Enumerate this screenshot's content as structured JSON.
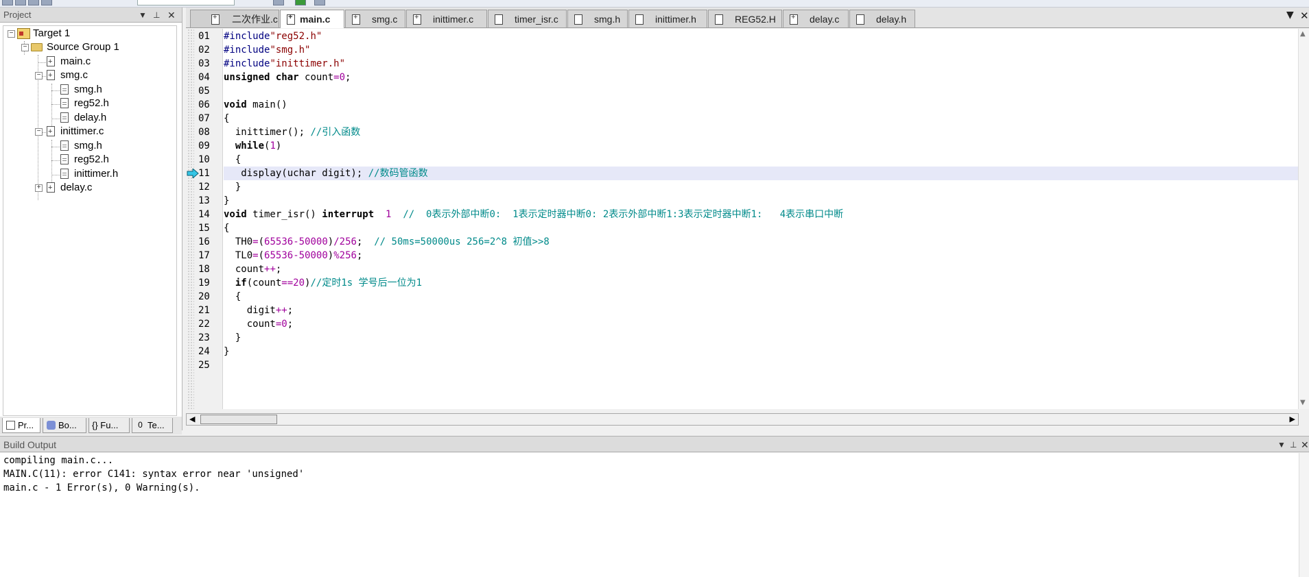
{
  "project_panel": {
    "title": "Project",
    "tree": {
      "target": "Target 1",
      "group": "Source Group 1",
      "main": "main.c",
      "smg": "smg.c",
      "smg_children": [
        "smg.h",
        "reg52.h",
        "delay.h"
      ],
      "inittimer": "inittimer.c",
      "inittimer_children": [
        "smg.h",
        "reg52.h",
        "inittimer.h"
      ],
      "delay": "delay.c"
    },
    "tabs": [
      "Pr...",
      "Bo...",
      "{} Fu...",
      "Te..."
    ]
  },
  "file_tabs": [
    "二次作业.c",
    "main.c",
    "smg.c",
    "inittimer.c",
    "timer_isr.c",
    "smg.h",
    "inittimer.h",
    "REG52.H",
    "delay.c",
    "delay.h"
  ],
  "active_tab": "main.c",
  "editor": {
    "current_line": 11,
    "lines": [
      {
        "n": "01",
        "t": "#include\"reg52.h\""
      },
      {
        "n": "02",
        "t": "#include\"smg.h\""
      },
      {
        "n": "03",
        "t": "#include\"inittimer.h\""
      },
      {
        "n": "04",
        "t": "unsigned char count=0;"
      },
      {
        "n": "05",
        "t": ""
      },
      {
        "n": "06",
        "t": "void main()"
      },
      {
        "n": "07",
        "t": "{"
      },
      {
        "n": "08",
        "t": "  inittimer(); //引入函数"
      },
      {
        "n": "09",
        "t": "  while(1)"
      },
      {
        "n": "10",
        "t": "  {"
      },
      {
        "n": "11",
        "t": "   display(uchar digit); //数码管函数"
      },
      {
        "n": "12",
        "t": "  }"
      },
      {
        "n": "13",
        "t": "}"
      },
      {
        "n": "14",
        "t": "void timer_isr() interrupt  1  //  0表示外部中断0:  1表示定时器中断0: 2表示外部中断1:3表示定时器中断1:   4表示串口中断"
      },
      {
        "n": "15",
        "t": "{"
      },
      {
        "n": "16",
        "t": "  TH0=(65536-50000)/256;  // 50ms=50000us 256=2^8 初值>>8"
      },
      {
        "n": "17",
        "t": "  TL0=(65536-50000)%256;"
      },
      {
        "n": "18",
        "t": "  count++;"
      },
      {
        "n": "19",
        "t": "  if(count==20)//定时1s 学号后一位为1"
      },
      {
        "n": "20",
        "t": "  {"
      },
      {
        "n": "21",
        "t": "    digit++;"
      },
      {
        "n": "22",
        "t": "    count=0;"
      },
      {
        "n": "23",
        "t": "  }"
      },
      {
        "n": "24",
        "t": "}"
      },
      {
        "n": "25",
        "t": ""
      }
    ]
  },
  "build_output": {
    "title": "Build Output",
    "lines": [
      "compiling main.c...",
      "MAIN.C(11): error C141: syntax error near 'unsigned'",
      "main.c - 1 Error(s), 0 Warning(s)."
    ]
  },
  "colors": {
    "keyword": "#000000",
    "preprocessor": "#000080",
    "string": "#8b0000",
    "number": "#a0009c",
    "comment": "#008a8a",
    "current_line_bg": "#e6e8f8"
  },
  "icons": [
    "toolbar-icon",
    "close-icon",
    "pin-icon",
    "dropdown-icon",
    "file-icon",
    "folder-icon",
    "target-icon",
    "arrow-icon"
  ]
}
